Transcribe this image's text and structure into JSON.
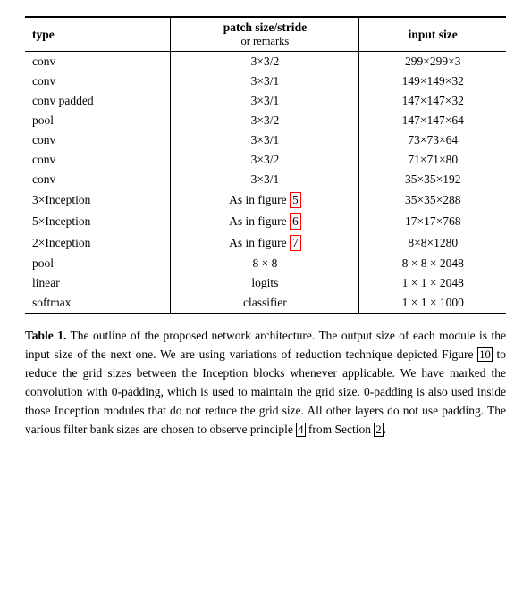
{
  "table": {
    "headers": {
      "type": "type",
      "patch": "patch size/stride",
      "patch_sub": "or remarks",
      "input": "input size"
    },
    "rows": [
      {
        "type": "conv",
        "patch": "3×3/2",
        "input": "299×299×3"
      },
      {
        "type": "conv",
        "patch": "3×3/1",
        "input": "149×149×32"
      },
      {
        "type": "conv padded",
        "patch": "3×3/1",
        "input": "147×147×32"
      },
      {
        "type": "pool",
        "patch": "3×3/2",
        "input": "147×147×64"
      },
      {
        "type": "conv",
        "patch": "3×3/1",
        "input": "73×73×64"
      },
      {
        "type": "conv",
        "patch": "3×3/2",
        "input": "71×71×80"
      },
      {
        "type": "conv",
        "patch": "3×3/1",
        "input": "35×35×192"
      },
      {
        "type": "3×Inception",
        "patch": "As in figure 5",
        "input": "35×35×288",
        "highlight": "5"
      },
      {
        "type": "5×Inception",
        "patch": "As in figure 6",
        "input": "17×17×768",
        "highlight": "6"
      },
      {
        "type": "2×Inception",
        "patch": "As in figure 7",
        "input": "8×8×1280",
        "highlight": "7"
      },
      {
        "type": "pool",
        "patch": "8 × 8",
        "input": "8 × 8 × 2048"
      },
      {
        "type": "linear",
        "patch": "logits",
        "input": "1 × 1 × 2048"
      },
      {
        "type": "softmax",
        "patch": "classifier",
        "input": "1 × 1 × 1000"
      }
    ]
  },
  "caption": {
    "label": "Table 1.",
    "text": " The outline of the proposed network architecture.  The output size of each module is the input size of the next one.  We are using variations of reduction technique depicted Figure ",
    "ref1": "10",
    "text2": " to reduce the grid sizes between the Inception blocks whenever applicable.  We have marked the convolution with 0-padding, which is used to maintain the grid size.  0-padding is also used inside those Inception modules that do not reduce the grid size.  All other layers do not use padding.  The various filter bank sizes are chosen to observe principle ",
    "ref2": "4",
    "text3": " from Section ",
    "ref3": "2",
    "text4": "."
  }
}
